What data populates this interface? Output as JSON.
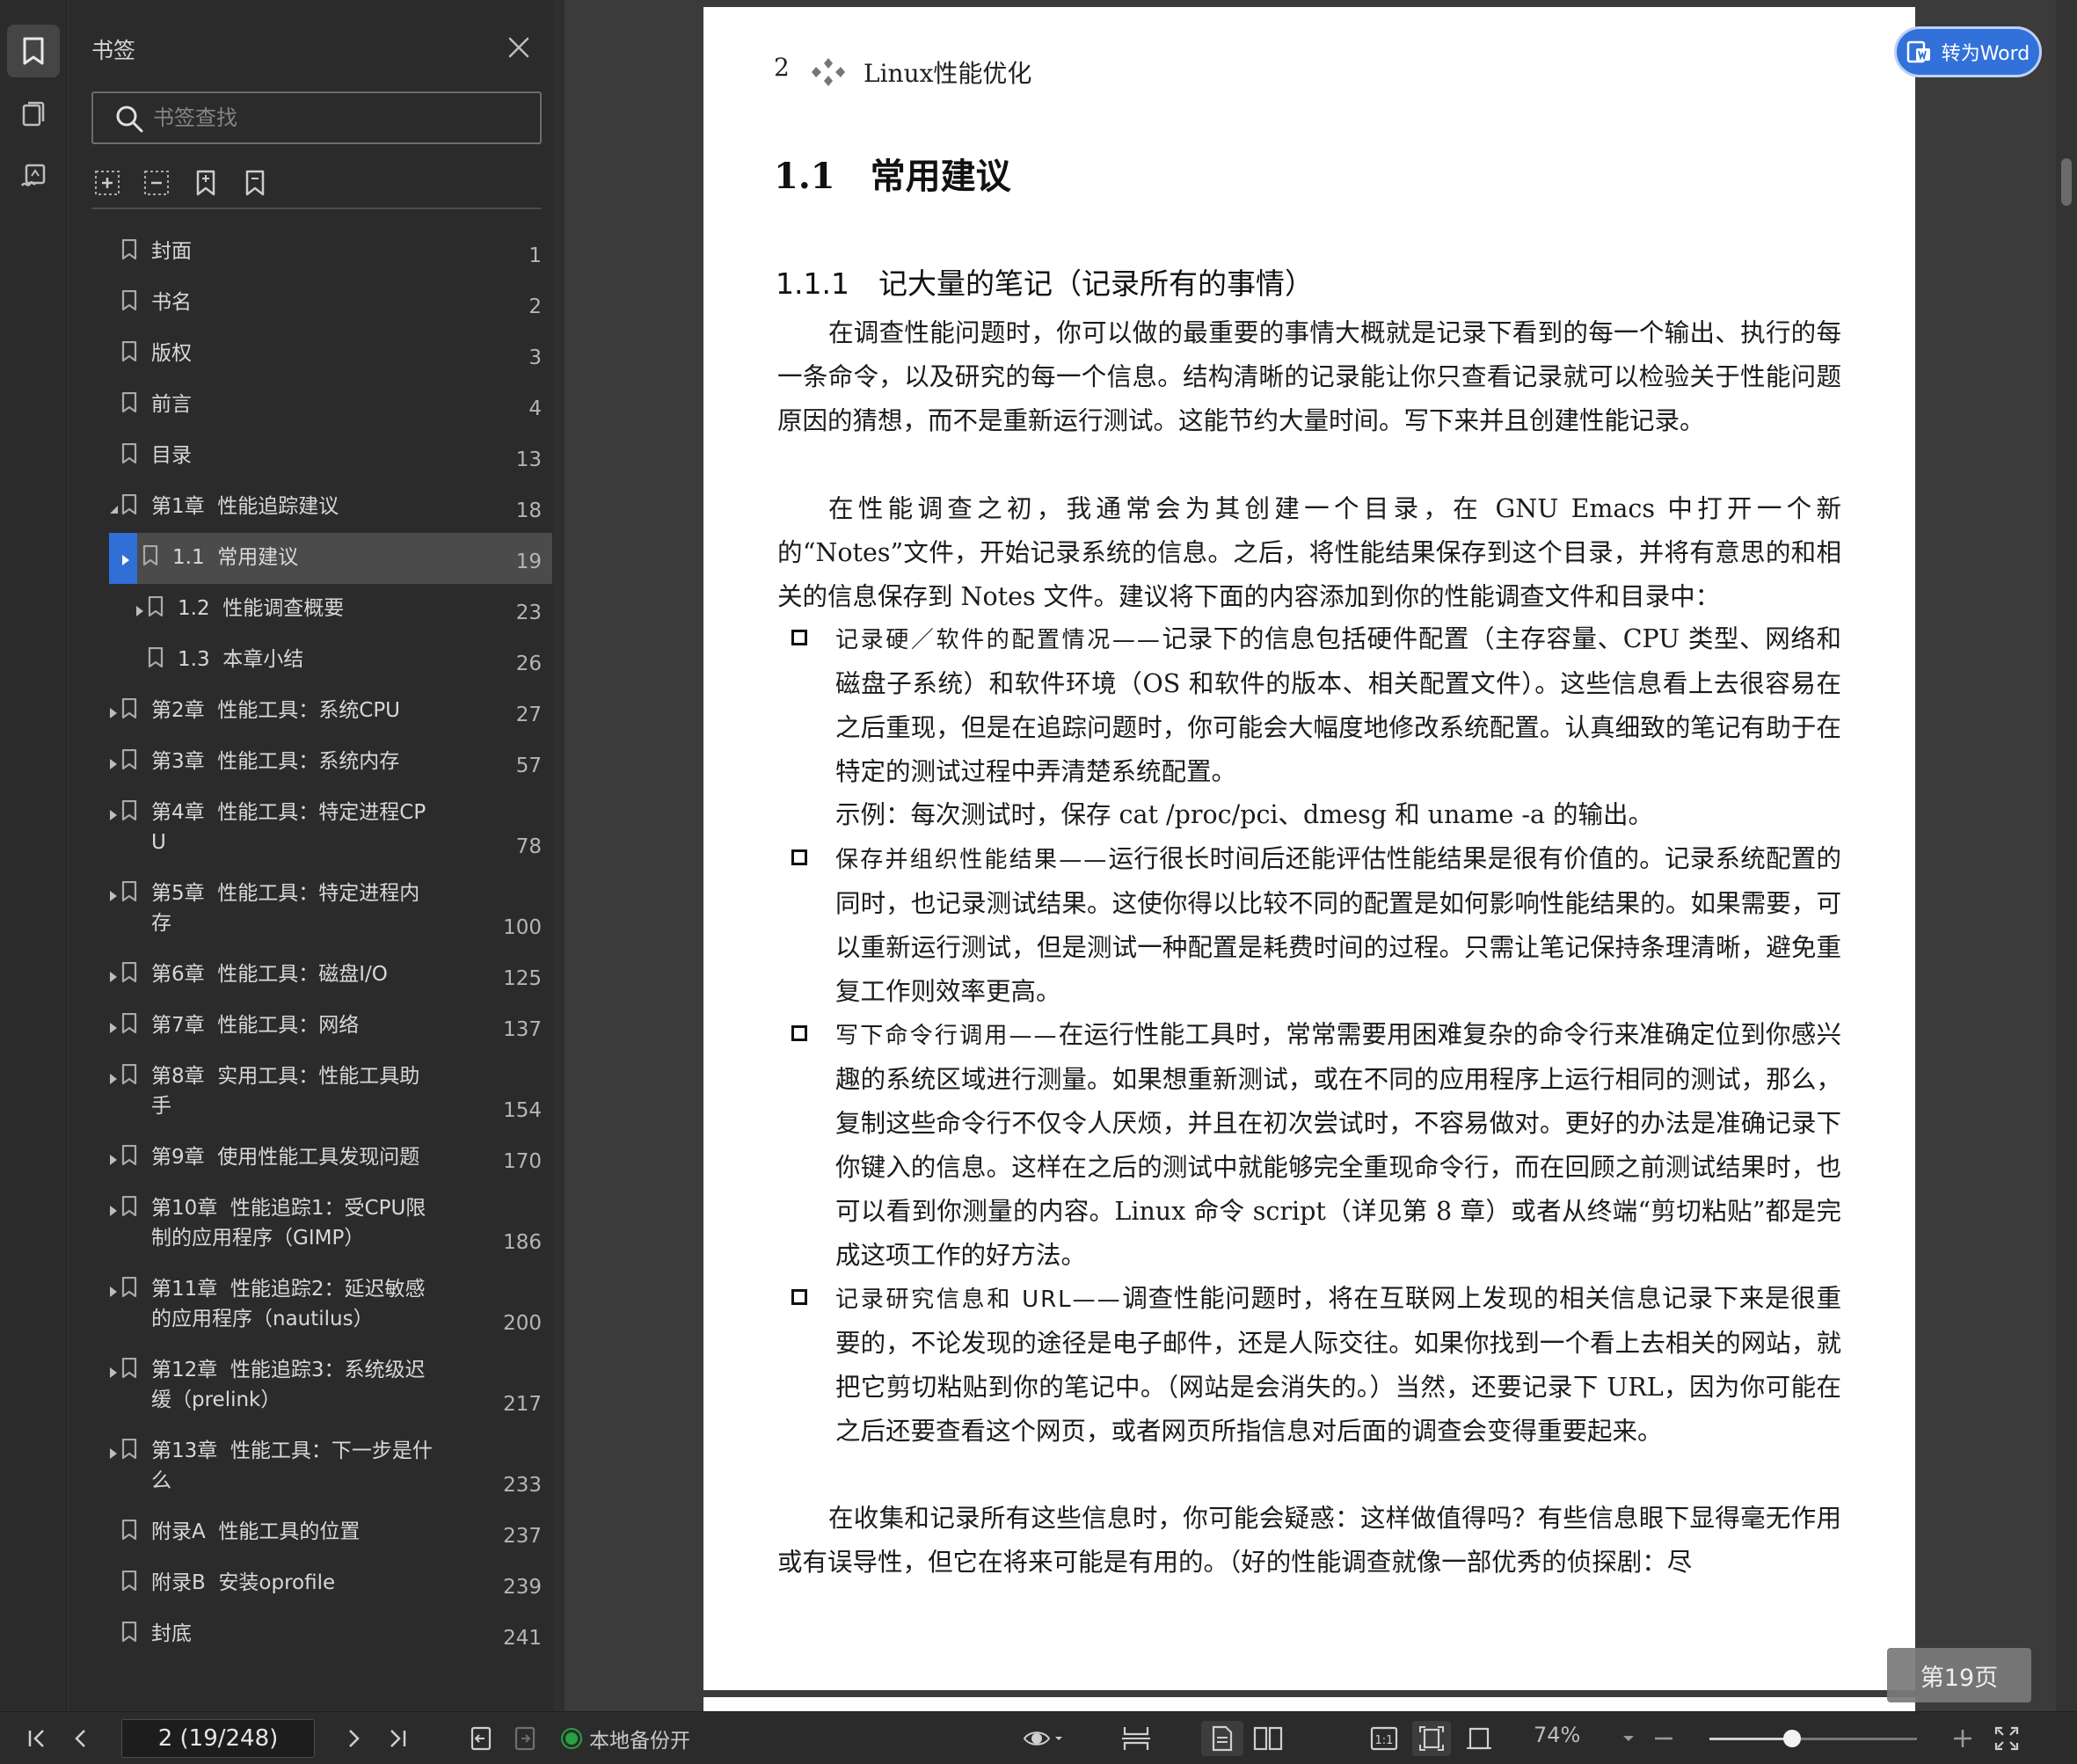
{
  "panel": {
    "title": "书签",
    "search_placeholder": "书签查找",
    "bookmarks": [
      {
        "label": "封面",
        "page": "1"
      },
      {
        "label": "书名",
        "page": "2"
      },
      {
        "label": "版权",
        "page": "3"
      },
      {
        "label": "前言",
        "page": "4"
      },
      {
        "label": "目录",
        "page": "13"
      },
      {
        "label": "第1章  性能追踪建议",
        "page": "18"
      },
      {
        "label": "1.1  常用建议",
        "page": "19"
      },
      {
        "label": "1.2  性能调查概要",
        "page": "23"
      },
      {
        "label": "1.3  本章小结",
        "page": "26"
      },
      {
        "label": "第2章  性能工具：系统CPU",
        "page": "27"
      },
      {
        "label": "第3章  性能工具：系统内存",
        "page": "57"
      },
      {
        "label": "第4章  性能工具：特定进程CP\nU",
        "page": "78"
      },
      {
        "label": "第5章  性能工具：特定进程内\n存",
        "page": "100"
      },
      {
        "label": "第6章  性能工具：磁盘I/O",
        "page": "125"
      },
      {
        "label": "第7章  性能工具：网络",
        "page": "137"
      },
      {
        "label": "第8章  实用工具：性能工具助\n手",
        "page": "154"
      },
      {
        "label": "第9章  使用性能工具发现问题",
        "page": "170"
      },
      {
        "label": "第10章  性能追踪1：受CPU限\n制的应用程序（GIMP）",
        "page": "186"
      },
      {
        "label": "第11章  性能追踪2：延迟敏感\n的应用程序（nautilus）",
        "page": "200"
      },
      {
        "label": "第12章  性能追踪3：系统级迟\n缓（prelink）",
        "page": "217"
      },
      {
        "label": "第13章  性能工具：下一步是什\n么",
        "page": "233"
      },
      {
        "label": "附录A  性能工具的位置",
        "page": "237"
      },
      {
        "label": "附录B  安装oprofile",
        "page": "239"
      },
      {
        "label": "封底",
        "page": "241"
      }
    ]
  },
  "document": {
    "page_number": "2",
    "running_title": "Linux性能优化",
    "section_title": "1.1　常用建议",
    "subsection_title": "1.1.1　记大量的笔记（记录所有的事情）",
    "p1": "在调查性能问题时，你可以做的最重要的事情大概就是记录下看到的每一个输出、执行的每一条命令，以及研究的每一个信息。结构清晰的记录能让你只查看记录就可以检验关于性能问题原因的猜想，而不是重新运行测试。这能节约大量时间。写下来并且创建性能记录。",
    "p2": "在性能调查之初，我通常会为其创建一个目录，在 GNU Emacs 中打开一个新的“Notes”文件，开始记录系统的信息。之后，将性能结果保存到这个目录，并将有意思的和相关的信息保存到 Notes 文件。建议将下面的内容添加到你的性能调查文件和目录中：",
    "b1_lead": "记录硬／软件的配置情况——",
    "b1_text": "记录下的信息包括硬件配置（主存容量、CPU 类型、网络和磁盘子系统）和软件环境（OS 和软件的版本、相关配置文件）。这些信息看上去很容易在之后重现，但是在追踪问题时，你可能会大幅度地修改系统配置。认真细致的笔记有助于在特定的测试过程中弄清楚系统配置。",
    "b1_example": "示例：每次测试时，保存 cat /proc/pci、dmesg 和 uname -a 的输出。",
    "b2_lead": "保存并组织性能结果——",
    "b2_text": "运行很长时间后还能评估性能结果是很有价值的。记录系统配置的同时，也记录测试结果。这使你得以比较不同的配置是如何影响性能结果的。如果需要，可以重新运行测试，但是测试一种配置是耗费时间的过程。只需让笔记保持条理清晰，避免重复工作则效率更高。",
    "b3_lead": "写下命令行调用——",
    "b3_text": "在运行性能工具时，常常需要用困难复杂的命令行来准确定位到你感兴趣的系统区域进行测量。如果想重新测试，或在不同的应用程序上运行相同的测试，那么，复制这些命令行不仅令人厌烦，并且在初次尝试时，不容易做对。更好的办法是准确记录下你键入的信息。这样在之后的测试中就能够完全重现命令行，而在回顾之前测试结果时，也可以看到你测量的内容。Linux 命令 script（详见第 8 章）或者从终端“剪切粘贴”都是完成这项工作的好方法。",
    "b4_lead": "记录研究信息和 URL——",
    "b4_text": "调查性能问题时，将在互联网上发现的相关信息记录下来是很重要的，不论发现的途径是电子邮件，还是人际交往。如果你找到一个看上去相关的网站，就把它剪切粘贴到你的笔记中。（网站是会消失的。）当然，还要记录下 URL，因为你可能在之后还要查看这个网页，或者网页所指信息对后面的调查会变得重要起来。",
    "p3": "在收集和记录所有这些信息时，你可能会疑惑：这样做值得吗？有些信息眼下显得毫无作用或有误导性，但它在将来可能是有用的。（好的性能调查就像一部优秀的侦探剧：尽"
  },
  "overlay": {
    "to_word": "转为Word",
    "page_badge": "第19页"
  },
  "status": {
    "page_field": "2 (19/248)",
    "backup": "本地备份开",
    "zoom": "74%",
    "zoom_level": 0.4
  },
  "colors": {
    "accent": "#3271d9",
    "selected_marker": "#2f6fd6",
    "backup_green": "#27a142"
  }
}
